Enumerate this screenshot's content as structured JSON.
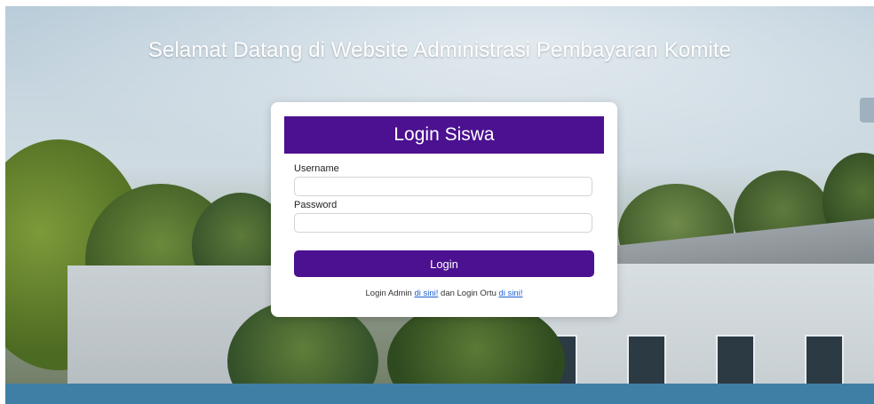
{
  "page": {
    "headline": "Selamat Datang di Website Administrasi Pembayaran Komite"
  },
  "login_card": {
    "title": "Login Siswa",
    "username_label": "Username",
    "username_value": "",
    "password_label": "Password",
    "password_value": "",
    "submit_label": "Login"
  },
  "footer": {
    "admin_prefix": "Login Admin ",
    "admin_link": "di sini!",
    "middle_text": " dan Login Ortu ",
    "ortu_link": "di sini!"
  },
  "colors": {
    "brand_purple": "#4b1190",
    "link_blue": "#1a5fd0"
  }
}
